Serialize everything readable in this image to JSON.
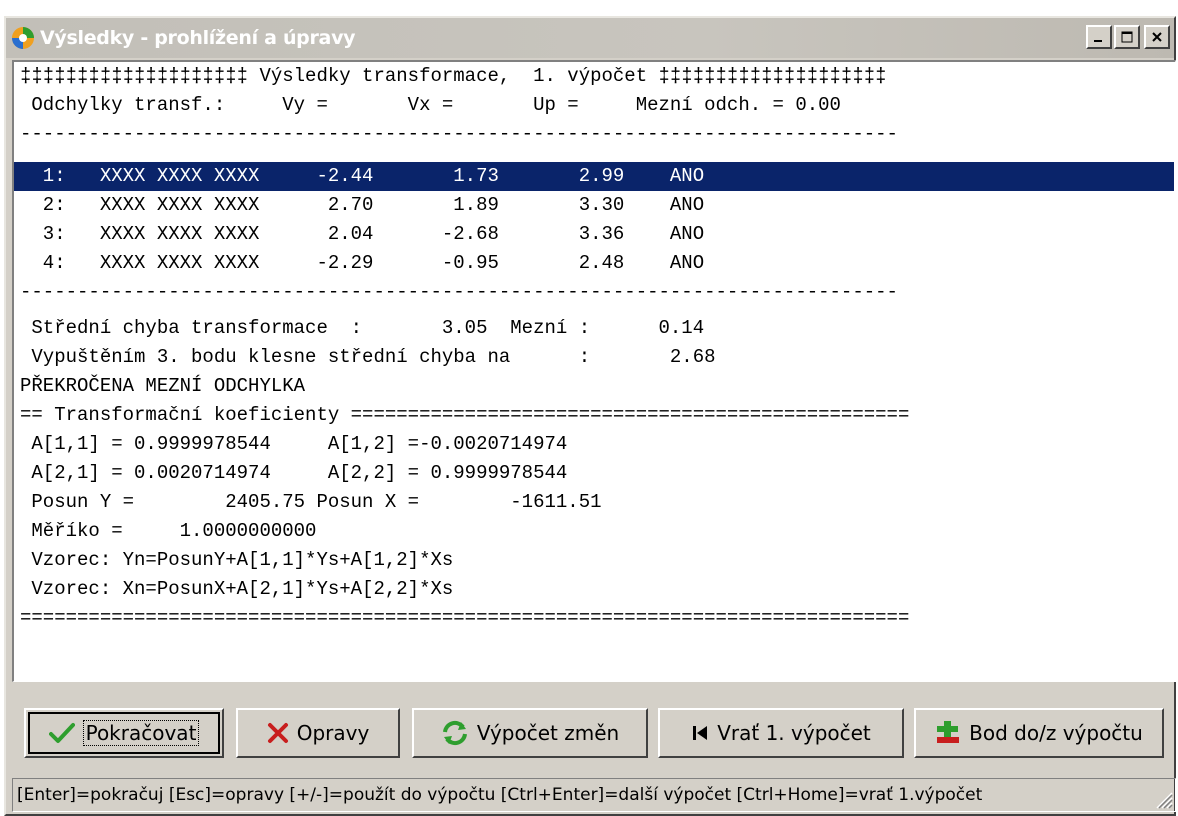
{
  "window": {
    "title": "Výsledky - prohlížení a úpravy"
  },
  "text_lines": [
    "‡‡‡‡‡‡‡‡‡‡‡‡‡‡‡‡‡‡‡‡ Výsledky transformace,  1. výpočet ‡‡‡‡‡‡‡‡‡‡‡‡‡‡‡‡‡‡‡‡",
    " Odchylky transf.:     Vy =       Vx =       Up =     Mezní odch. = 0.00",
    "-----------------------------------------------------------------------------",
    "  1:   XXXX XXXX XXXX     -2.44       1.73       2.99    ANO",
    "  2:   XXXX XXXX XXXX      2.70       1.89       3.30    ANO",
    "  3:   XXXX XXXX XXXX      2.04      -2.68       3.36    ANO",
    "  4:   XXXX XXXX XXXX     -2.29      -0.95       2.48    ANO",
    "-----------------------------------------------------------------------------",
    " Střední chyba transformace  :       3.05  Mezní :      0.14",
    " Vypuštěním 3. bodu klesne střední chyba na      :       2.68",
    "PŘEKROČENA MEZNÍ ODCHYLKA",
    "== Transformační koeficienty =================================================",
    " A[1,1] = 0.9999978544     A[1,2] =-0.0020714974",
    " A[2,1] = 0.0020714974     A[2,2] = 0.9999978544",
    " Posun Y =        2405.75 Posun X =        -1611.51",
    " Měříko =     1.0000000000",
    " Vzorec: Yn=PosunY+A[1,1]*Ys+A[1,2]*Xs",
    " Vzorec: Xn=PosunX+A[2,1]*Ys+A[2,2]*Xs",
    "=============================================================================="
  ],
  "selected_line_index": 3,
  "buttons": {
    "continue": "Pokračovat",
    "corrections": "Opravy",
    "recalc": "Výpočet změn",
    "revert": "Vrať 1. výpočet",
    "point_toggle": "Bod do/z výpočtu"
  },
  "status_bar": "[Enter]=pokračuj [Esc]=opravy [+/-]=použít do výpočtu [Ctrl+Enter]=další výpočet [Ctrl+Home]=vrať 1.výpočet",
  "colors": {
    "selection": "#0a246a",
    "face": "#d4d0c8",
    "check_green": "#2e9e2e",
    "x_red": "#c81e1e"
  }
}
